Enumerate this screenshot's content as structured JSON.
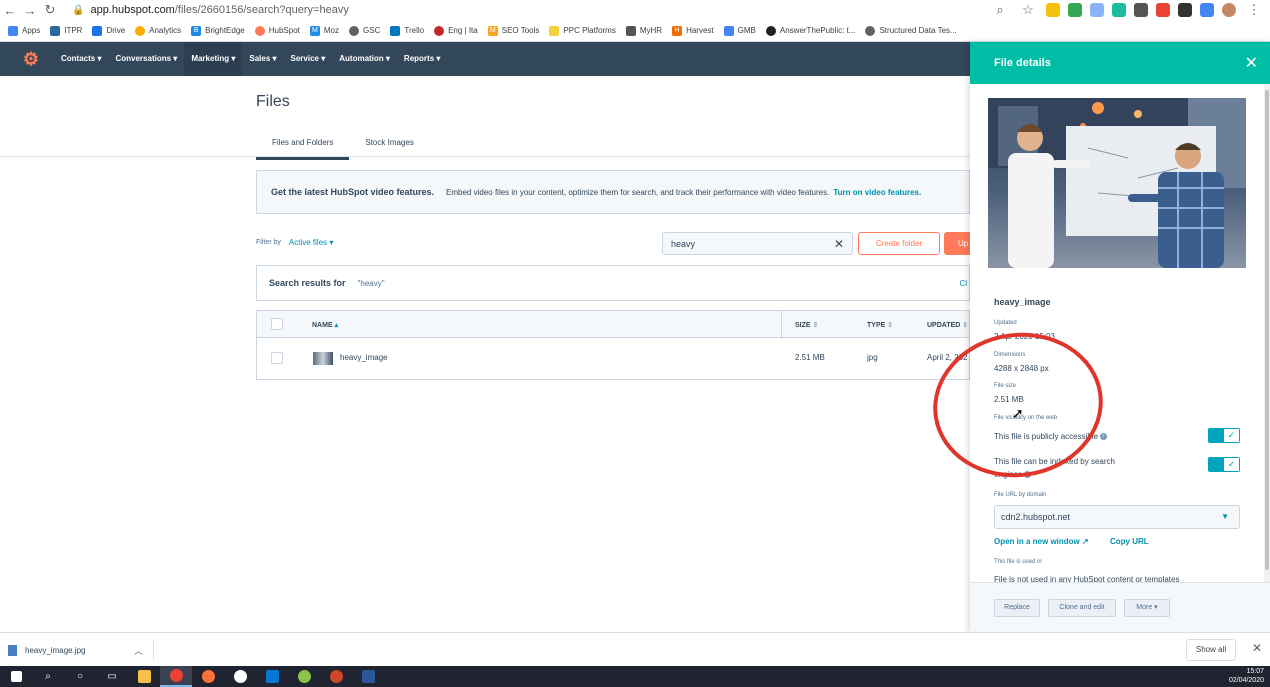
{
  "browser": {
    "url_host": "app.hubspot.com",
    "url_path": "/files/2660156/search?query=heavy",
    "bookmarks": [
      {
        "label": "Apps",
        "color": "#4285f4"
      },
      {
        "label": "ITPR",
        "color": "#2d6a9f"
      },
      {
        "label": "Drive",
        "color": "#1a73e8"
      },
      {
        "label": "Analytics",
        "color": "#f9ab00"
      },
      {
        "label": "BrightEdge",
        "color": "#1e88e5"
      },
      {
        "label": "HubSpot",
        "color": "#ff7a59"
      },
      {
        "label": "Moz",
        "color": "#1f8ce6"
      },
      {
        "label": "GSC",
        "color": "#5f6368"
      },
      {
        "label": "Trello",
        "color": "#0079bf"
      },
      {
        "label": "Eng | Ita",
        "color": "#c62828"
      },
      {
        "label": "SEO Tools",
        "color": "#f6a623"
      },
      {
        "label": "PPC Platforms",
        "color": "#f4d03f"
      },
      {
        "label": "MyHR",
        "color": "#555555"
      },
      {
        "label": "Harvest",
        "color": "#f36c00"
      },
      {
        "label": "GMB",
        "color": "#4285f4"
      },
      {
        "label": "AnswerThePublic: t...",
        "color": "#222222"
      },
      {
        "label": "Structured Data Tes...",
        "color": "#5f6368"
      }
    ]
  },
  "nav": {
    "items": [
      "Contacts",
      "Conversations",
      "Marketing",
      "Sales",
      "Service",
      "Automation",
      "Reports"
    ],
    "active": "Marketing"
  },
  "page": {
    "title": "Files",
    "tabs": [
      "Files and Folders",
      "Stock Images"
    ],
    "banner_title": "Get the latest HubSpot video features.",
    "banner_text": "Embed video files in your content, optimize them for search, and track their performance with video features.",
    "banner_link": "Turn on video features.",
    "filter_label": "Filter by",
    "filter_value": "Active files",
    "search_value": "heavy",
    "create_folder": "Create folder",
    "upload": "Up",
    "results_label": "Search results for",
    "results_query": "\"heavy\"",
    "results_clear": "Cl"
  },
  "table": {
    "headers": {
      "name": "NAME",
      "size": "SIZE",
      "type": "TYPE",
      "updated": "UPDATED"
    },
    "rows": [
      {
        "name": "heavy_image",
        "size": "2.51 MB",
        "type": "jpg",
        "updated": "April 2, 202"
      }
    ]
  },
  "panel": {
    "title": "File details",
    "file_name": "heavy_image",
    "updated_label": "Updated",
    "updated_value": "2 Apr 2020 15:03",
    "dimensions_label": "Dimensions",
    "dimensions_value": "4288 x 2848 px",
    "filesize_label": "File size",
    "filesize_value": "2.51 MB",
    "visibility_label": "File visibility on the web",
    "public_label": "This file is publicly accessible",
    "indexed_label": "This file can be indexed by search engines",
    "url_domain_label": "File URL by domain",
    "url_domain_value": "cdn2.hubspot.net",
    "open_link": "Open in a new window",
    "copy_link": "Copy URL",
    "used_in_label": "This file is used in",
    "used_in_value": "File is not used in any HubSpot content or templates",
    "btn_replace": "Replace",
    "btn_clone": "Clone and edit",
    "btn_more": "More"
  },
  "downloads": {
    "file": "heavy_image.jpg",
    "show_all": "Show all"
  },
  "taskbar": {
    "time": "15:07",
    "date": "02/04/2020"
  },
  "colors": {
    "nav_bg": "#33475b",
    "accent": "#00bda5",
    "link": "#0091ae",
    "orange": "#ff7a59",
    "annotation": "#e0352b"
  }
}
